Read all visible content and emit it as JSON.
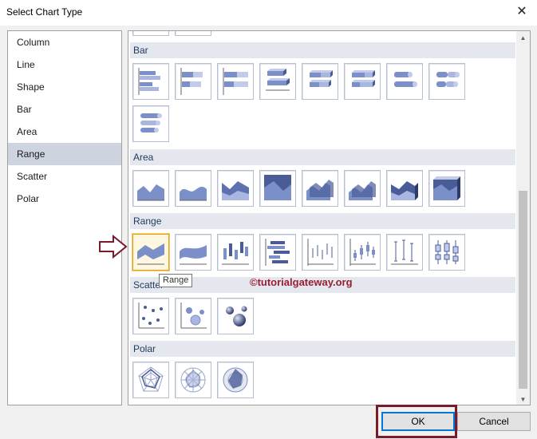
{
  "window": {
    "title": "Select Chart Type",
    "close_icon": "close-icon"
  },
  "categories": [
    {
      "label": "Column"
    },
    {
      "label": "Line"
    },
    {
      "label": "Shape"
    },
    {
      "label": "Bar"
    },
    {
      "label": "Area"
    },
    {
      "label": "Range",
      "selected": true
    },
    {
      "label": "Scatter"
    },
    {
      "label": "Polar"
    }
  ],
  "sections": {
    "bar": {
      "label": "Bar",
      "tiles": [
        "bar-clustered",
        "bar-stacked",
        "bar-100-stacked",
        "bar-3d-clustered",
        "bar-3d-stacked",
        "bar-3d-100-stacked",
        "bar-cylinder-clustered",
        "bar-cylinder-stacked",
        "bar-cylinder-100-stacked"
      ]
    },
    "area": {
      "label": "Area",
      "tiles": [
        "area",
        "area-smooth",
        "area-stacked",
        "area-100-stacked",
        "area-3d",
        "area-3d-smooth",
        "area-3d-stacked",
        "area-3d-100-stacked"
      ]
    },
    "range": {
      "label": "Range",
      "tiles": [
        "range",
        "range-smooth",
        "range-column",
        "range-bar",
        "error-bar",
        "stock",
        "error-bar-ticks",
        "box-plot"
      ]
    },
    "scatter": {
      "label": "Scatter",
      "tiles": [
        "scatter",
        "bubble",
        "bubble-3d"
      ]
    },
    "polar": {
      "label": "Polar",
      "tiles": [
        "radar",
        "polar",
        "radar-3d"
      ]
    }
  },
  "tooltip": "Range",
  "watermark": "©tutorialgateway.org",
  "buttons": {
    "ok": "OK",
    "cancel": "Cancel"
  },
  "colors": {
    "accent": "#e3a21a",
    "selection": "#cdd3df",
    "highlight": "#7a1b2a",
    "icon_fill": "#6f83bf"
  }
}
